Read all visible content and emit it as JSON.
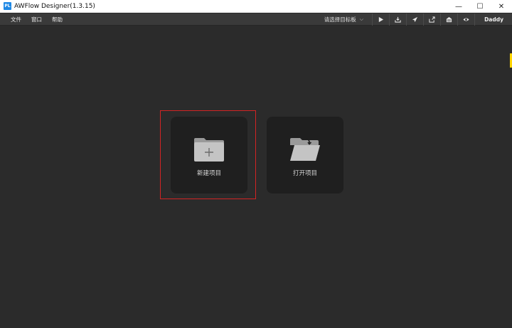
{
  "window": {
    "app_icon_text": "PL",
    "title": "AWFlow Designer(1.3.15)",
    "controls": {
      "minimize": "—",
      "maximize": "☐",
      "close": "✕"
    }
  },
  "menu": {
    "items": [
      "文件",
      "窗口",
      "帮助"
    ]
  },
  "toolbar": {
    "board_select": "请选择目标板",
    "icons": [
      "play-icon",
      "download-icon",
      "send-icon",
      "export-icon",
      "home-icon",
      "eye-icon"
    ],
    "user": "Daddy"
  },
  "cards": {
    "new_project": {
      "label": "新建项目"
    },
    "open_project": {
      "label": "打开项目"
    }
  },
  "colors": {
    "background": "#2b2b2b",
    "card": "#1f1f1f",
    "highlight": "#d32424",
    "menubar": "#3a3a3a"
  }
}
